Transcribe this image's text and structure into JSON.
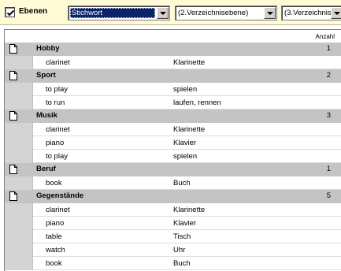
{
  "toolbar": {
    "levels_label": "Ebenen",
    "levels_checked": true,
    "combo1": "Stichwort",
    "combo2": "(2.Verzeichnisebene)",
    "combo3": "(3.Verzeichnisebene)"
  },
  "grid": {
    "count_header": "Anzahl",
    "groups": [
      {
        "name": "Hobby",
        "count": "1",
        "items": [
          {
            "en": "clarinet",
            "de": "Klarinette"
          }
        ]
      },
      {
        "name": "Sport",
        "count": "2",
        "items": [
          {
            "en": "to play",
            "de": "spielen"
          },
          {
            "en": "to run",
            "de": "laufen, rennen"
          }
        ]
      },
      {
        "name": "Musik",
        "count": "3",
        "items": [
          {
            "en": "clarinet",
            "de": "Klarinette"
          },
          {
            "en": "piano",
            "de": "Klavier"
          },
          {
            "en": "to play",
            "de": "spielen"
          }
        ]
      },
      {
        "name": "Beruf",
        "count": "1",
        "items": [
          {
            "en": "book",
            "de": "Buch"
          }
        ]
      },
      {
        "name": "Gegenstände",
        "count": "5",
        "items": [
          {
            "en": "clarinet",
            "de": "Klarinette"
          },
          {
            "en": "piano",
            "de": "Klavier"
          },
          {
            "en": "table",
            "de": "Tisch"
          },
          {
            "en": "watch",
            "de": "Uhr"
          },
          {
            "en": "book",
            "de": "Buch"
          }
        ]
      }
    ]
  }
}
